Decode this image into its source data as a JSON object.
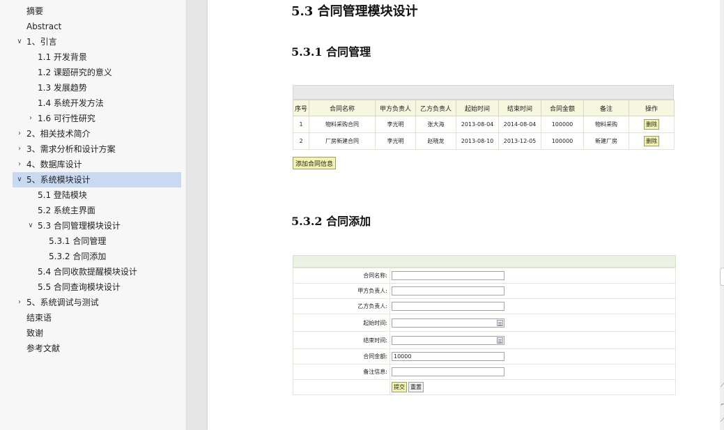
{
  "sidebar": {
    "items": [
      {
        "label": "摘要",
        "chevron": ""
      },
      {
        "label": "Abstract",
        "chevron": ""
      },
      {
        "label": "1、引言",
        "chevron": "down"
      },
      {
        "label": "1.1  开发背景",
        "chevron": ""
      },
      {
        "label": "1.2  课题研究的意义",
        "chevron": ""
      },
      {
        "label": "1.3  发展趋势",
        "chevron": ""
      },
      {
        "label": "1.4  系统开发方法",
        "chevron": ""
      },
      {
        "label": "1.6  可行性研究",
        "chevron": "right"
      },
      {
        "label": "2、相关技术简介",
        "chevron": "right"
      },
      {
        "label": "3、需求分析和设计方案",
        "chevron": "right"
      },
      {
        "label": "4、数据库设计",
        "chevron": "right"
      },
      {
        "label": "5、系统模块设计",
        "chevron": "down",
        "active": true
      },
      {
        "label": "5.1  登陆模块",
        "chevron": ""
      },
      {
        "label": "5.2  系统主界面",
        "chevron": ""
      },
      {
        "label": "5.3  合同管理模块设计",
        "chevron": "down"
      },
      {
        "label": "5.3.1  合同管理",
        "chevron": ""
      },
      {
        "label": "5.3.2  合同添加",
        "chevron": ""
      },
      {
        "label": "5.4  合同收款提醒模块设计",
        "chevron": ""
      },
      {
        "label": "5.5  合同查询模块设计",
        "chevron": ""
      },
      {
        "label": "5、系统调试与测试",
        "chevron": "right"
      },
      {
        "label": "结束语",
        "chevron": ""
      },
      {
        "label": "致谢",
        "chevron": ""
      },
      {
        "label": "参考文献",
        "chevron": ""
      }
    ]
  },
  "document": {
    "heading_53": "5.3  合同管理模块设计",
    "heading_531": "5.3.1  合同管理",
    "heading_532": "5.3.2  合同添加",
    "contract_table": {
      "headers": [
        "序号",
        "合同名称",
        "甲方负责人",
        "乙方负责人",
        "起始时间",
        "结束时间",
        "合同金额",
        "备注",
        "操作"
      ],
      "rows": [
        [
          "1",
          "物料采购合同",
          "李光明",
          "张大海",
          "2013-08-04",
          "2014-08-04",
          "100000",
          "物料采购",
          "删除"
        ],
        [
          "2",
          "厂房新建合同",
          "李光明",
          "赵晓龙",
          "2013-08-10",
          "2013-12-05",
          "100000",
          "新建厂房",
          "删除"
        ]
      ],
      "add_button": "添加合同信息"
    },
    "add_form": {
      "fields": [
        {
          "label": "合同名称:",
          "value": "",
          "calendar": false
        },
        {
          "label": "甲方负责人:",
          "value": "",
          "calendar": false
        },
        {
          "label": "乙方负责人:",
          "value": "",
          "calendar": false
        },
        {
          "label": "起始时间:",
          "value": "",
          "calendar": true
        },
        {
          "label": "结束时间:",
          "value": "",
          "calendar": true
        },
        {
          "label": "合同金额:",
          "value": "10000",
          "calendar": false
        },
        {
          "label": "备注信息:",
          "value": "",
          "calendar": false
        }
      ],
      "submit": "提交",
      "reset": "重置"
    }
  },
  "colors": {
    "active_nav": "#c9d9f2",
    "button_yellow": "#f3f3b0",
    "table_header": "#f7f7df",
    "form_header": "#ebf2e4"
  }
}
